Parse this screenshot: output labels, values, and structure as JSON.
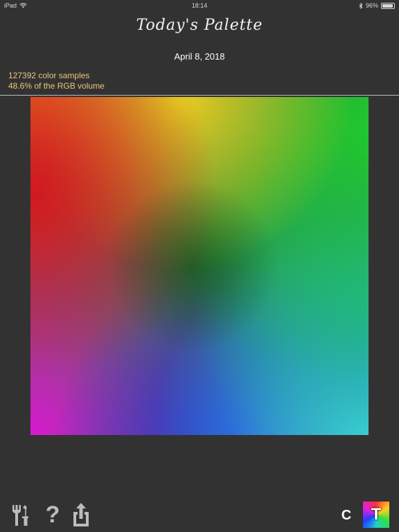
{
  "status_bar": {
    "device": "iPad",
    "time": "18:14",
    "battery": "96%",
    "battery_level": 0.96
  },
  "header": {
    "title": "Today's Palette",
    "date": "April 8, 2018"
  },
  "stats": {
    "samples": "127392 color samples",
    "volume": "48.6% of the RGB volume"
  },
  "toolbar": {
    "help_label": "?",
    "c_label": "C",
    "t_label": "T"
  },
  "icons": [
    "wifi-icon",
    "bluetooth-icon",
    "battery-icon",
    "tools-icon",
    "help-icon",
    "share-icon"
  ],
  "colors": {
    "background": "#333232",
    "stats_text": "#e8c878",
    "icon_gray": "#bcbcbc"
  }
}
